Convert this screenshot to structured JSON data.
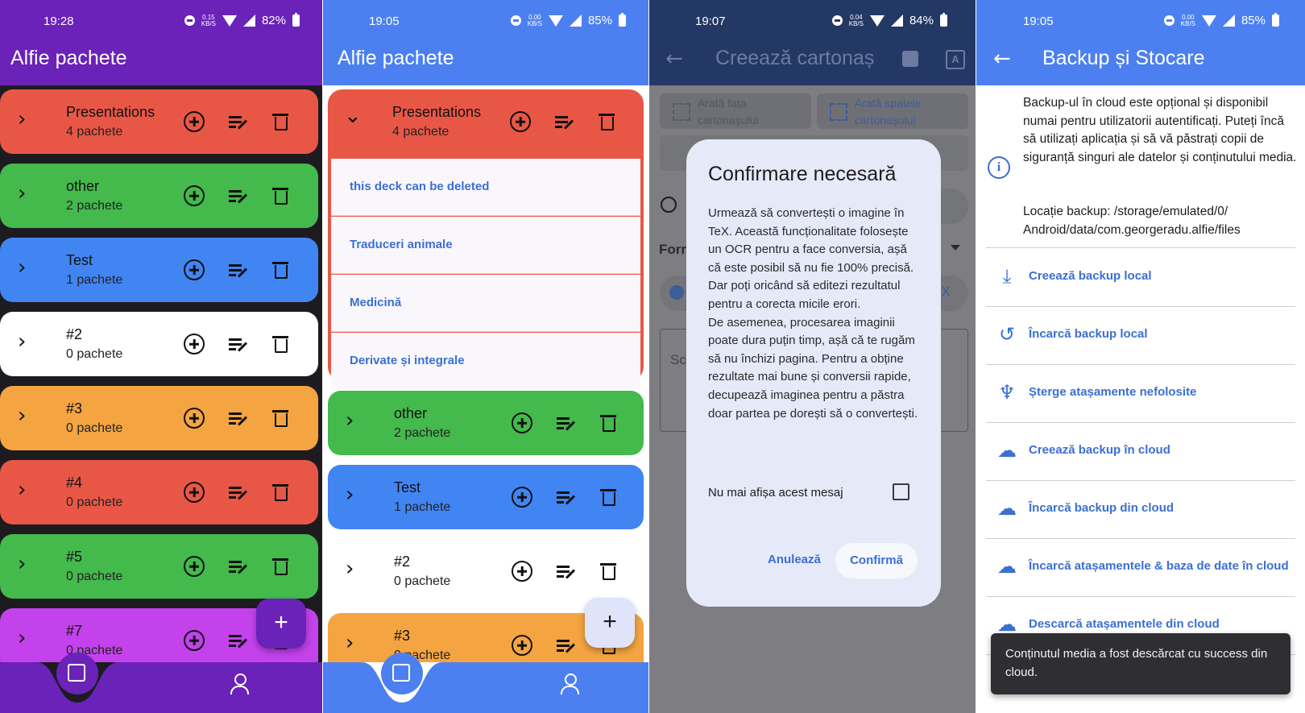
{
  "panel1": {
    "status": {
      "time": "19:28",
      "speed_top": "0.15",
      "speed_unit": "KB/S",
      "battery": "82%"
    },
    "title": "Alfie pachete",
    "decks": [
      {
        "name": "Presentations",
        "count": "4 pachete",
        "color": "#e85746"
      },
      {
        "name": "other",
        "count": "2 pachete",
        "color": "#44b94c"
      },
      {
        "name": "Test",
        "count": "1 pachete",
        "color": "#4185f3"
      },
      {
        "name": "#2",
        "count": "0 pachete",
        "color": "#ffffff"
      },
      {
        "name": "#3",
        "count": "0 pachete",
        "color": "#f4a440"
      },
      {
        "name": "#4",
        "count": "0 pachete",
        "color": "#e85746"
      },
      {
        "name": "#5",
        "count": "0 pachete",
        "color": "#44b94c"
      },
      {
        "name": "#7",
        "count": "0 pachete",
        "color": "#c342ec"
      }
    ],
    "fab": "+",
    "accent": "#6a22b8"
  },
  "panel2": {
    "status": {
      "time": "19:05",
      "speed_top": "0.00",
      "speed_unit": "KB/S",
      "battery": "85%"
    },
    "title": "Alfie pachete",
    "expanded_deck": {
      "name": "Presentations",
      "count": "4 pachete",
      "color": "#e85746"
    },
    "subdecks": [
      "this deck can be deleted",
      "Traduceri animale",
      "Medicină",
      "Derivate și integrale"
    ],
    "decks": [
      {
        "name": "other",
        "count": "2 pachete",
        "color": "#44b94c"
      },
      {
        "name": "Test",
        "count": "1 pachete",
        "color": "#4185f3"
      },
      {
        "name": "#2",
        "count": "0 pachete",
        "color": "#ffffff"
      },
      {
        "name": "#3",
        "count": "0 pachete",
        "color": "#f4a440"
      }
    ],
    "fab": "+",
    "accent": "#4c80f0"
  },
  "panel3": {
    "status": {
      "time": "19:07",
      "speed_top": "0.04",
      "speed_unit": "KB/S",
      "battery": "84%"
    },
    "title": "Creează cartonaș",
    "tab_front": "Arată fața cartonașului",
    "tab_back": "Arată spatele cartonașului",
    "format_fragment": "Forr",
    "tex_fragment": "eX",
    "sc_fragment": "Sc",
    "dialog": {
      "title": "Confirmare necesară",
      "body": "Urmează să convertești o imagine în TeX. Această funcționalitate folosește un OCR pentru a face conversia, așă că este posibil să nu fie 100% precisă. Dar poți oricând să editezi rezultatul pentru a corecta micile erori.\nDe asemenea, procesarea imaginii poate dura puțin timp, așă că te rugăm să nu închizi pagina. Pentru a obține rezultate mai bune și conversii rapide, decupează imaginea pentru a păstra doar partea pe dorești să o convertești.",
      "checkbox_label": "Nu mai afișa acest mesaj",
      "cancel": "Anulează",
      "confirm": "Confirmă"
    }
  },
  "panel4": {
    "status": {
      "time": "19:05",
      "speed_top": "0.00",
      "speed_unit": "KB/S",
      "battery": "85%"
    },
    "title": "Backup și Stocare",
    "info": "Backup-ul în cloud este opțional și disponibil numai pentru utilizatorii autentificați. Puteți încă să utilizați aplicația și să vă păstrați copii de siguranță singuri ale datelor și conținutului media.",
    "location": "Locație backup: /storage/emulated/0/ Android/data/com.georgeradu.alfie/files",
    "items": [
      {
        "label": "Creează backup local",
        "icon": "download-icon"
      },
      {
        "label": "Încarcă backup local",
        "icon": "restore-icon"
      },
      {
        "label": "Șterge atașamente nefolosite",
        "icon": "broom-icon"
      },
      {
        "label": "Creează backup în cloud",
        "icon": "cloud-upload-icon"
      },
      {
        "label": "Încarcă backup din cloud",
        "icon": "cloud-download-icon"
      },
      {
        "label": "Încarcă atașamentele & baza de date în cloud",
        "icon": "cloud-upload-icon"
      },
      {
        "label": "Descarcă atașamentele din cloud",
        "icon": "cloud-download-icon"
      }
    ],
    "snackbar": "Conținutul media a fost descărcat cu success din cloud.",
    "accent": "#4c80f0"
  }
}
